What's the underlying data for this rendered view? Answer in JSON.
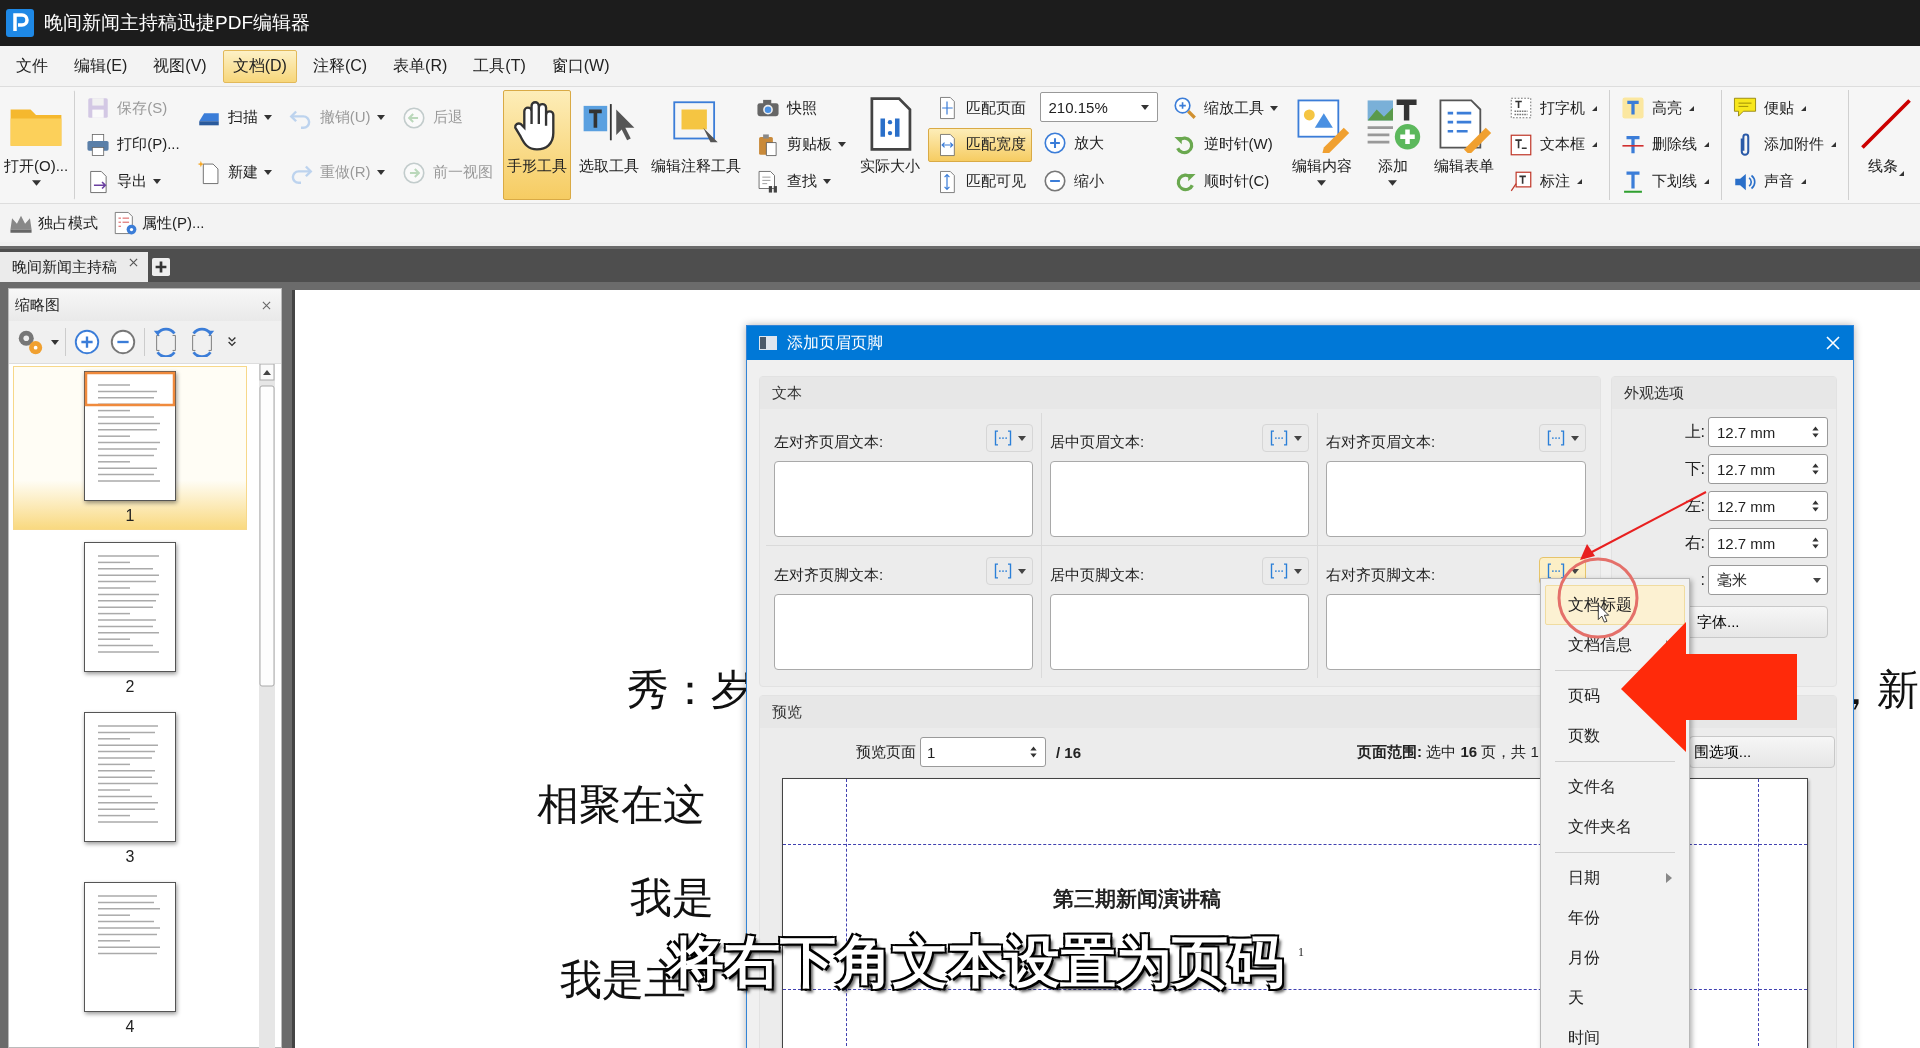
{
  "window": {
    "title": "晚间新闻主持稿迅捷PDF编辑器"
  },
  "menu": [
    {
      "label": "文件",
      "selected": false
    },
    {
      "label": "编辑(E)",
      "selected": false
    },
    {
      "label": "视图(V)",
      "selected": false
    },
    {
      "label": "文档(D)",
      "selected": true
    },
    {
      "label": "注释(C)",
      "selected": false
    },
    {
      "label": "表单(R)",
      "selected": false
    },
    {
      "label": "工具(T)",
      "selected": false
    },
    {
      "label": "窗口(W)",
      "selected": false
    }
  ],
  "ribbon": [
    {
      "kind": "large",
      "label": "打开(O)...",
      "selected": false,
      "disabled": false,
      "dropdown": true,
      "corner_arrow": false,
      "divider": true
    },
    {
      "kind": "stack",
      "divider": false,
      "items": [
        {
          "kind": "button",
          "label": "保存(S)",
          "selected": false,
          "disabled": true,
          "dropdown": false,
          "corner_arrow": false
        },
        {
          "kind": "button",
          "label": "打印(P)...",
          "selected": false,
          "disabled": false,
          "dropdown": false,
          "corner_arrow": false
        },
        {
          "kind": "button",
          "label": "导出",
          "selected": false,
          "disabled": false,
          "dropdown": true,
          "corner_arrow": false
        }
      ]
    },
    {
      "kind": "stack",
      "divider": false,
      "items": [
        {
          "kind": "button",
          "label": "扫描",
          "selected": false,
          "disabled": false,
          "dropdown": true,
          "corner_arrow": false
        },
        {
          "kind": "button",
          "label": "新建",
          "selected": false,
          "disabled": false,
          "dropdown": true,
          "corner_arrow": false
        }
      ]
    },
    {
      "kind": "stack",
      "divider": false,
      "items": [
        {
          "kind": "button",
          "label": "撤销(U)",
          "selected": false,
          "disabled": true,
          "dropdown": true,
          "corner_arrow": false
        },
        {
          "kind": "button",
          "label": "重做(R)",
          "selected": false,
          "disabled": true,
          "dropdown": true,
          "corner_arrow": false
        }
      ]
    },
    {
      "kind": "stack",
      "divider": false,
      "items": [
        {
          "kind": "button",
          "label": "后退",
          "selected": false,
          "disabled": true,
          "dropdown": false,
          "corner_arrow": false
        },
        {
          "kind": "button",
          "label": "前一视图",
          "selected": false,
          "disabled": true,
          "dropdown": false,
          "corner_arrow": false
        }
      ]
    },
    {
      "kind": "large",
      "label": "手形工具",
      "selected": true,
      "disabled": false,
      "dropdown": false,
      "corner_arrow": false,
      "divider": false
    },
    {
      "kind": "large",
      "label": "选取工具",
      "selected": false,
      "disabled": false,
      "dropdown": false,
      "corner_arrow": false,
      "divider": false
    },
    {
      "kind": "large",
      "label": "编辑注释工具",
      "selected": false,
      "disabled": false,
      "dropdown": false,
      "corner_arrow": false,
      "divider": false
    },
    {
      "kind": "stack",
      "divider": false,
      "items": [
        {
          "kind": "button",
          "label": "快照",
          "selected": false,
          "disabled": false,
          "dropdown": false,
          "corner_arrow": false
        },
        {
          "kind": "button",
          "label": "剪贴板",
          "selected": false,
          "disabled": false,
          "dropdown": true,
          "corner_arrow": false
        },
        {
          "kind": "button",
          "label": "查找",
          "selected": false,
          "disabled": false,
          "dropdown": true,
          "corner_arrow": false
        }
      ]
    },
    {
      "kind": "large",
      "label": "实际大小",
      "selected": false,
      "disabled": false,
      "dropdown": false,
      "corner_arrow": false,
      "divider": false
    },
    {
      "kind": "stack",
      "divider": false,
      "items": [
        {
          "kind": "button",
          "label": "匹配页面",
          "selected": false,
          "disabled": false,
          "dropdown": false,
          "corner_arrow": false
        },
        {
          "kind": "button",
          "label": "匹配宽度",
          "selected": true,
          "disabled": false,
          "dropdown": false,
          "corner_arrow": false
        },
        {
          "kind": "button",
          "label": "匹配可见",
          "selected": false,
          "disabled": false,
          "dropdown": false,
          "corner_arrow": false
        }
      ]
    },
    {
      "kind": "stack",
      "divider": false,
      "items": [
        {
          "kind": "combo",
          "value": "210.15%"
        },
        {
          "kind": "button",
          "label": "放大",
          "selected": false,
          "disabled": false,
          "dropdown": false,
          "corner_arrow": false
        },
        {
          "kind": "button",
          "label": "缩小",
          "selected": false,
          "disabled": false,
          "dropdown": false,
          "corner_arrow": false
        }
      ]
    },
    {
      "kind": "stack",
      "divider": false,
      "items": [
        {
          "kind": "button",
          "label": "缩放工具",
          "selected": false,
          "disabled": false,
          "dropdown": true,
          "corner_arrow": false
        },
        {
          "kind": "button",
          "label": "逆时针(W)",
          "selected": false,
          "disabled": false,
          "dropdown": false,
          "corner_arrow": false
        },
        {
          "kind": "button",
          "label": "顺时针(C)",
          "selected": false,
          "disabled": false,
          "dropdown": false,
          "corner_arrow": false
        }
      ]
    },
    {
      "kind": "large",
      "label": "编辑内容",
      "selected": false,
      "disabled": false,
      "dropdown": true,
      "corner_arrow": false,
      "divider": false
    },
    {
      "kind": "large",
      "label": "添加",
      "selected": false,
      "disabled": false,
      "dropdown": true,
      "corner_arrow": false,
      "divider": false
    },
    {
      "kind": "large",
      "label": "编辑表单",
      "selected": false,
      "disabled": false,
      "dropdown": false,
      "corner_arrow": false,
      "divider": false
    },
    {
      "kind": "stack",
      "divider": true,
      "items": [
        {
          "kind": "button",
          "label": "打字机",
          "selected": false,
          "disabled": false,
          "dropdown": false,
          "corner_arrow": true
        },
        {
          "kind": "button",
          "label": "文本框",
          "selected": false,
          "disabled": false,
          "dropdown": false,
          "corner_arrow": true
        },
        {
          "kind": "button",
          "label": "标注",
          "selected": false,
          "disabled": false,
          "dropdown": false,
          "corner_arrow": true
        }
      ]
    },
    {
      "kind": "stack",
      "divider": true,
      "items": [
        {
          "kind": "button",
          "label": "高亮",
          "selected": false,
          "disabled": false,
          "dropdown": false,
          "corner_arrow": true
        },
        {
          "kind": "button",
          "label": "删除线",
          "selected": false,
          "disabled": false,
          "dropdown": false,
          "corner_arrow": true
        },
        {
          "kind": "button",
          "label": "下划线",
          "selected": false,
          "disabled": false,
          "dropdown": false,
          "corner_arrow": true
        }
      ]
    },
    {
      "kind": "stack",
      "divider": true,
      "items": [
        {
          "kind": "button",
          "label": "便贴",
          "selected": false,
          "disabled": false,
          "dropdown": false,
          "corner_arrow": true
        },
        {
          "kind": "button",
          "label": "添加附件",
          "selected": false,
          "disabled": false,
          "dropdown": false,
          "corner_arrow": true
        },
        {
          "kind": "button",
          "label": "声音",
          "selected": false,
          "disabled": false,
          "dropdown": false,
          "corner_arrow": true
        }
      ]
    },
    {
      "kind": "large",
      "label": "线条",
      "selected": false,
      "disabled": false,
      "dropdown": false,
      "corner_arrow": true,
      "divider": false
    }
  ],
  "quick_bar": [
    "独占模式",
    "属性(P)..."
  ],
  "doc_tab": {
    "label": "晚间新闻主持稿"
  },
  "thumbnails": {
    "title": "缩略图",
    "pages": [
      {
        "label": "1",
        "selected": true
      },
      {
        "label": "2",
        "selected": false
      },
      {
        "label": "3",
        "selected": false
      },
      {
        "label": "4",
        "selected": false
      }
    ]
  },
  "document_text": [
    {
      "text": "秀：岁"
    },
    {
      "text": "相聚在这"
    },
    {
      "text": "我是"
    },
    {
      "text": "我是主"
    },
    {
      "text": "，新"
    }
  ],
  "dialog": {
    "title": "添加页眉页脚",
    "text_group": "文本",
    "cells": [
      {
        "label": "左对齐页眉文本:",
        "selected": false
      },
      {
        "label": "居中页眉文本:",
        "selected": false
      },
      {
        "label": "右对齐页眉文本:",
        "selected": false
      },
      {
        "label": "左对齐页脚文本:",
        "selected": false
      },
      {
        "label": "居中页脚文本:",
        "selected": false
      },
      {
        "label": "右对齐页脚文本:",
        "selected": true
      }
    ],
    "appearance": {
      "title": "外观选项",
      "margins": [
        {
          "label": "上:",
          "value": "12.7 mm"
        },
        {
          "label": "下:",
          "value": "12.7 mm"
        },
        {
          "label": "左:",
          "value": "12.7 mm"
        },
        {
          "label": "右:",
          "value": "12.7 mm"
        }
      ],
      "unit_label": ":",
      "unit_value": "毫米",
      "font_button": "字体..."
    },
    "preview": {
      "title": "预览",
      "page_label": "预览页面",
      "page_value": "1",
      "page_total": "/ 16",
      "range": "**页面范围:** 选中 **16** 页，共 1",
      "range_button": "围选项...",
      "heading": "第三期新闻演讲稿",
      "page_number": "1"
    }
  },
  "context_menu": [
    {
      "kind": "item",
      "label": "文档标题",
      "selected": true
    },
    {
      "kind": "submenu",
      "label": "文档信息",
      "selected": false
    },
    {
      "kind": "separator"
    },
    {
      "kind": "item",
      "label": "页码",
      "selected": false
    },
    {
      "kind": "item",
      "label": "页数",
      "selected": false
    },
    {
      "kind": "separator"
    },
    {
      "kind": "item",
      "label": "文件名",
      "selected": false
    },
    {
      "kind": "item",
      "label": "文件夹名",
      "selected": false
    },
    {
      "kind": "separator"
    },
    {
      "kind": "submenu",
      "label": "日期",
      "selected": false
    },
    {
      "kind": "item",
      "label": "年份",
      "selected": false
    },
    {
      "kind": "item",
      "label": "月份",
      "selected": false
    },
    {
      "kind": "item",
      "label": "天",
      "selected": false
    },
    {
      "kind": "item",
      "label": "时间",
      "selected": false
    }
  ],
  "caption": "将右下角文本设置为页码"
}
